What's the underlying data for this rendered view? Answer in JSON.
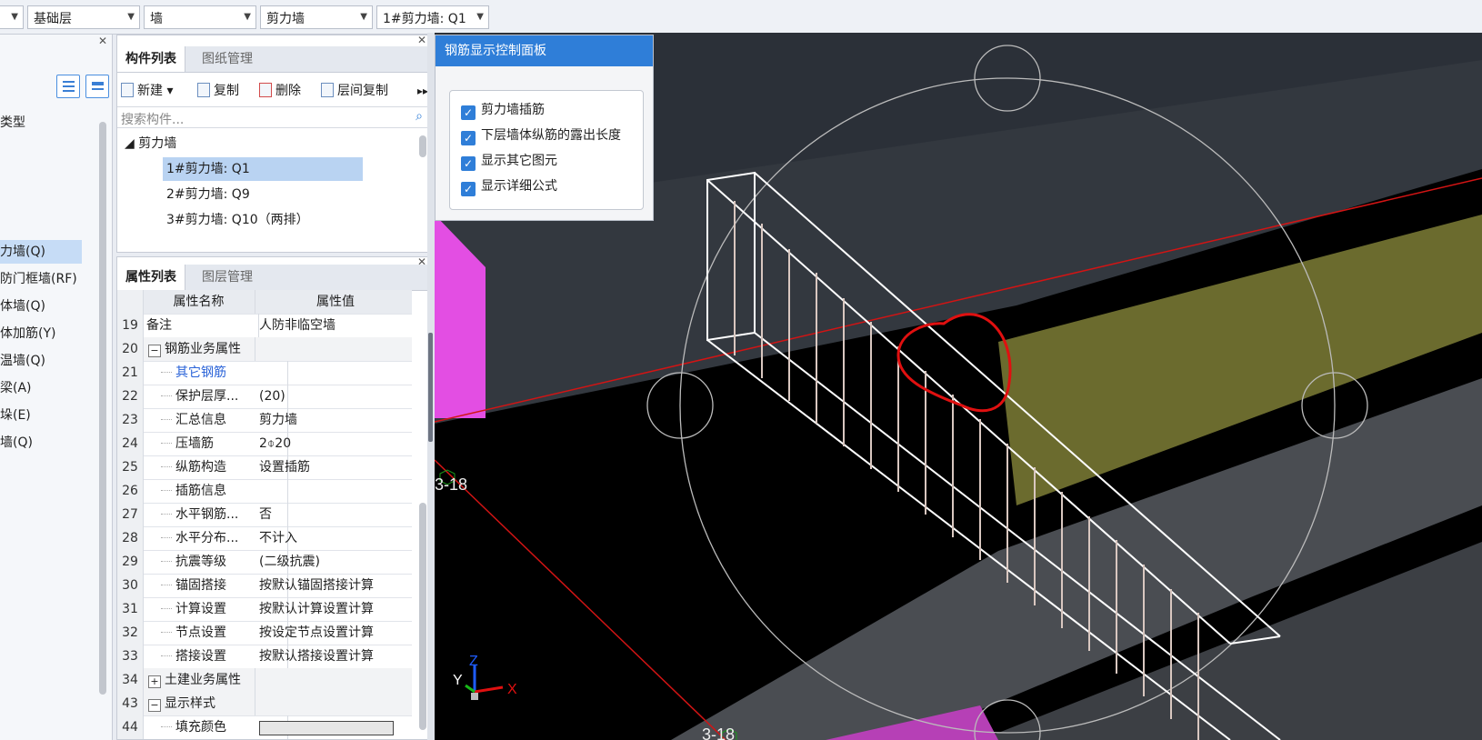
{
  "toolbar": {
    "combos": [
      {
        "value": ""
      },
      {
        "value": "基础层"
      },
      {
        "value": "墙"
      },
      {
        "value": "剪力墙"
      },
      {
        "value": "1#剪力墙:  Q1"
      }
    ]
  },
  "left_panel": {
    "header_item": "类型",
    "items": [
      {
        "label": "力墙(Q)",
        "selected": true
      },
      {
        "label": "防门框墙(RF)",
        "selected": false
      },
      {
        "label": "体墙(Q)",
        "selected": false
      },
      {
        "label": "体加筋(Y)",
        "selected": false
      },
      {
        "label": "温墙(Q)",
        "selected": false
      },
      {
        "label": "梁(A)",
        "selected": false
      },
      {
        "label": "垛(E)",
        "selected": false
      },
      {
        "label": "墙(Q)",
        "selected": false
      }
    ]
  },
  "component_panel": {
    "tabs": [
      "构件列表",
      "图纸管理"
    ],
    "buttons": {
      "new": "新建",
      "copy": "复制",
      "delete": "删除",
      "floor_copy": "层间复制"
    },
    "search_placeholder": "搜索构件...",
    "root": "剪力墙",
    "items": [
      {
        "label": "1#剪力墙:  Q1",
        "selected": true
      },
      {
        "label": "2#剪力墙:  Q9",
        "selected": false
      },
      {
        "label": "3#剪力墙:  Q10（两排）",
        "selected": false
      }
    ]
  },
  "property_panel": {
    "tabs": [
      "属性列表",
      "图层管理"
    ],
    "col_name": "属性名称",
    "col_value": "属性值",
    "rows": [
      {
        "num": "19",
        "name": "备注",
        "value": "人防非临空墙"
      },
      {
        "num": "20",
        "name": "钢筋业务属性",
        "value": "",
        "expander": "−"
      },
      {
        "num": "21",
        "name": "其它钢筋",
        "value": ""
      },
      {
        "num": "22",
        "name": "保护层厚...",
        "value": "(20)"
      },
      {
        "num": "23",
        "name": "汇总信息",
        "value": "剪力墙"
      },
      {
        "num": "24",
        "name": "压墙筋",
        "value": "2⌽20"
      },
      {
        "num": "25",
        "name": "纵筋构造",
        "value": "设置插筋"
      },
      {
        "num": "26",
        "name": "插筋信息",
        "value": ""
      },
      {
        "num": "27",
        "name": "水平钢筋...",
        "value": "否"
      },
      {
        "num": "28",
        "name": "水平分布...",
        "value": "不计入"
      },
      {
        "num": "29",
        "name": "抗震等级",
        "value": "(二级抗震)"
      },
      {
        "num": "30",
        "name": "锚固搭接",
        "value": "按默认锚固搭接计算"
      },
      {
        "num": "31",
        "name": "计算设置",
        "value": "按默认计算设置计算"
      },
      {
        "num": "32",
        "name": "节点设置",
        "value": "按设定节点设置计算"
      },
      {
        "num": "33",
        "name": "搭接设置",
        "value": "按默认搭接设置计算"
      },
      {
        "num": "34",
        "name": "土建业务属性",
        "value": "",
        "expander": "+"
      },
      {
        "num": "43",
        "name": "显示样式",
        "value": "",
        "expander": "−"
      },
      {
        "num": "44",
        "name": "填充颜色",
        "value": ""
      }
    ]
  },
  "rebar_panel": {
    "title": "钢筋显示控制面板",
    "options": [
      {
        "label": "剪力墙插筋",
        "checked": true
      },
      {
        "label": "下层墙体纵筋的露出长度",
        "checked": true
      },
      {
        "label": "显示其它图元",
        "checked": true
      },
      {
        "label": "显示详细公式",
        "checked": true
      }
    ]
  },
  "viewport": {
    "grid_labels": [
      "3-18",
      "3-18"
    ],
    "axes": {
      "x": "X",
      "y": "Y",
      "z": "Z"
    },
    "colors": {
      "wall_band": "#6b6b2e",
      "pink_block": "#e34ee3",
      "grid_line": "#d21414",
      "annotation": "#e01010"
    }
  }
}
